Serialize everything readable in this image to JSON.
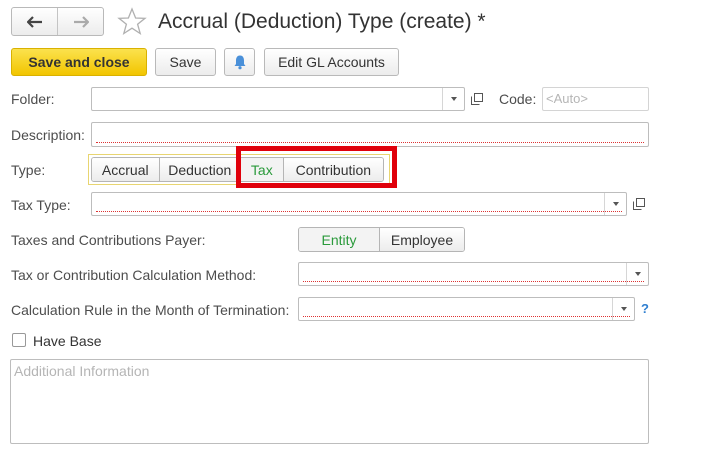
{
  "header": {
    "title": "Accrual (Deduction) Type (create) *"
  },
  "toolbar": {
    "save_close_label": "Save and close",
    "save_label": "Save",
    "edit_gl_label": "Edit GL Accounts"
  },
  "form": {
    "folder_label": "Folder:",
    "code_label": "Code:",
    "code_placeholder": "<Auto>",
    "description_label": "Description:",
    "type_label": "Type:",
    "type_options": [
      "Accrual",
      "Deduction",
      "Tax",
      "Contribution"
    ],
    "type_selected": "Tax",
    "tax_type_label": "Tax Type:",
    "payer_label": "Taxes and Contributions Payer:",
    "payer_options": [
      "Entity",
      "Employee"
    ],
    "payer_selected": "Entity",
    "calc_method_label": "Tax or Contribution Calculation Method:",
    "calc_rule_label": "Calculation Rule in the Month of Termination:",
    "help_mark": "?",
    "have_base_label": "Have Base",
    "additional_placeholder": "Additional Information"
  },
  "colors": {
    "accent_yellow": "#f2c500",
    "selected_green": "#2a9a3b",
    "highlight_red": "#e0000b"
  }
}
